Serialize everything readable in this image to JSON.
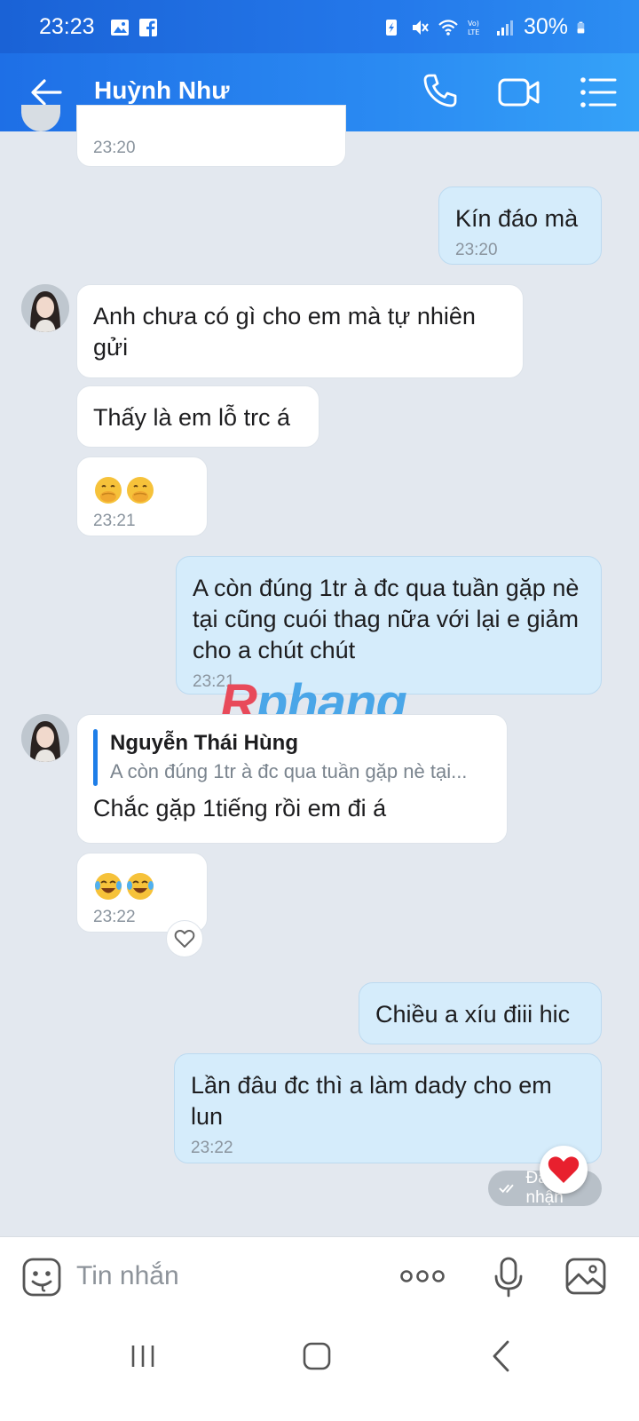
{
  "status_bar": {
    "time": "23:23",
    "battery": "30%",
    "icons": [
      "image-icon",
      "facebook-icon",
      "battery-saver-icon",
      "mute-icon",
      "wifi-icon",
      "volte-icon",
      "signal-icon",
      "battery-icon"
    ]
  },
  "header": {
    "contact_name": "Huỳnh Như"
  },
  "messages": [
    {
      "id": "m0",
      "dir": "in",
      "text": "",
      "time": "23:20"
    },
    {
      "id": "m1",
      "dir": "out",
      "text": "Kín đáo mà",
      "time": "23:20"
    },
    {
      "id": "m2",
      "dir": "in",
      "text": "Anh chưa có gì cho em mà tự nhiên gửi",
      "time": ""
    },
    {
      "id": "m3",
      "dir": "in",
      "text": "Thấy là em lỗ trc á",
      "time": ""
    },
    {
      "id": "m4",
      "dir": "in",
      "emoji": [
        "hand-over-mouth-emoji",
        "hand-over-mouth-emoji"
      ],
      "time": "23:21"
    },
    {
      "id": "m5",
      "dir": "out",
      "text": "A còn đúng 1tr à đc qua tuần gặp nè tại cũng cuói thag nữa với lại e giảm cho a chút chút",
      "time": "23:21"
    },
    {
      "id": "m6",
      "dir": "in",
      "quote_author": "Nguyễn Thái Hùng",
      "quote_text": "A còn đúng 1tr à đc qua tuần gặp nè tại...",
      "text": "Chắc gặp 1tiếng rồi em đi á",
      "time": ""
    },
    {
      "id": "m7",
      "dir": "in",
      "emoji": [
        "tears-of-joy-emoji",
        "tears-of-joy-emoji"
      ],
      "time": "23:22"
    },
    {
      "id": "m8",
      "dir": "out",
      "text": "Chiều a xíu điii hic",
      "time": ""
    },
    {
      "id": "m9",
      "dir": "out",
      "text": "Lần đâu đc thì a làm dady cho em lun",
      "time": "23:22"
    }
  ],
  "status_received": "Đã nhận",
  "watermark": {
    "first": "R",
    "rest": "phang"
  },
  "composer": {
    "placeholder": "Tin nhắn"
  },
  "colors": {
    "header_start": "#1e6fe6",
    "header_end": "#35a2f8",
    "outgoing_bubble": "#d5ecfb",
    "incoming_bubble": "#ffffff",
    "chat_bg": "#e3e8ef"
  }
}
